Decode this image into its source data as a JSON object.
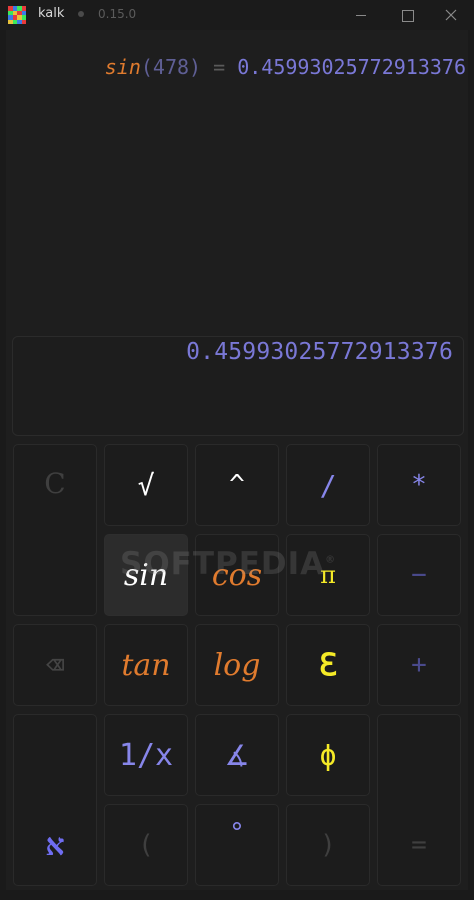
{
  "window": {
    "app_name": "kalk",
    "version": "0.15.0"
  },
  "history": [
    {
      "fn": "sin",
      "open": "(",
      "arg": "478",
      "close": ")",
      "eq": "=",
      "result": "0.45993025772913376"
    }
  ],
  "display": {
    "value": "0.45993025772913376"
  },
  "keys": {
    "clear": "C",
    "sqrt": "√",
    "power": "^",
    "divide": "/",
    "multiply": "*",
    "sin": "sin",
    "cos": "cos",
    "pi": "π",
    "minus": "−",
    "backspace": "⌫",
    "tan": "tan",
    "log": "log",
    "e": "ℇ",
    "plus": "+",
    "aleph": "א",
    "reciprocal": "1/x",
    "angle": "∡",
    "phi": "ϕ",
    "lparen": "(",
    "degree": "°",
    "rparen": ")",
    "equals": "="
  },
  "watermark": {
    "text": "SOFTPEDIA",
    "mark": "®"
  },
  "colors": {
    "function": "#e07b2e",
    "result": "#7a78d6",
    "operator": "#8786ea",
    "constant": "#f5ea27",
    "background": "#1a1a1a"
  }
}
